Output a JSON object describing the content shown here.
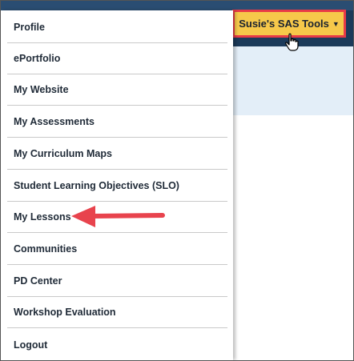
{
  "header": {
    "tools_button_label": "Susie's SAS Tools",
    "caret_icon": "caret-down-icon"
  },
  "menu": {
    "items": [
      {
        "label": "Profile"
      },
      {
        "label": "ePortfolio"
      },
      {
        "label": "My Website"
      },
      {
        "label": "My Assessments"
      },
      {
        "label": "My Curriculum Maps"
      },
      {
        "label": "Student Learning Objectives (SLO)"
      },
      {
        "label": "My Lessons"
      },
      {
        "label": "Communities"
      },
      {
        "label": "PD Center"
      },
      {
        "label": "Workshop Evaluation"
      },
      {
        "label": "Logout"
      }
    ]
  },
  "annotation": {
    "arrow_target": "My Lessons",
    "arrow_color": "#e8434d",
    "highlight_color": "#e83a47"
  },
  "colors": {
    "topbar": "#1b3a5a",
    "button_bg": "#f6c84a",
    "light_band": "#e3eef8"
  }
}
